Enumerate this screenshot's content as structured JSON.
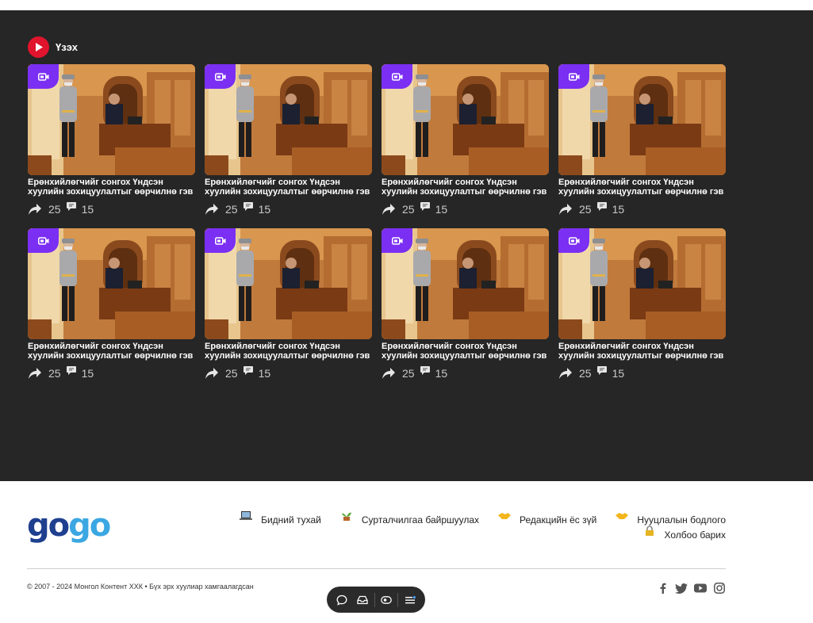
{
  "section": {
    "title": "Үзэх",
    "icon": "play-icon",
    "accent": "#e0142c"
  },
  "cards": [
    {
      "title": "Ерөнхийлөгчийг сонгох Үндсэн хуулийн зохицуулалтыг өөрчилнө гэв үү?",
      "shares": "25",
      "comments": "15"
    },
    {
      "title": "Ерөнхийлөгчийг сонгох Үндсэн хуулийн зохицуулалтыг өөрчилнө гэв үү?",
      "shares": "25",
      "comments": "15"
    },
    {
      "title": "Ерөнхийлөгчийг сонгох Үндсэн хуулийн зохицуулалтыг өөрчилнө гэв үү?",
      "shares": "25",
      "comments": "15"
    },
    {
      "title": "Ерөнхийлөгчийг сонгох Үндсэн хуулийн зохицуулалтыг өөрчилнө гэв үү?",
      "shares": "25",
      "comments": "15"
    },
    {
      "title": "Ерөнхийлөгчийг сонгох Үндсэн хуулийн зохицуулалтыг өөрчилнө гэв үү?",
      "shares": "25",
      "comments": "15"
    },
    {
      "title": "Ерөнхийлөгчийг сонгох Үндсэн хуулийн зохицуулалтыг өөрчилнө гэв үү?",
      "shares": "25",
      "comments": "15"
    },
    {
      "title": "Ерөнхийлөгчийг сонгох Үндсэн хуулийн зохицуулалтыг өөрчилнө гэв үү?",
      "shares": "25",
      "comments": "15"
    },
    {
      "title": "Ерөнхийлөгчийг сонгох Үндсэн хуулийн зохицуулалтыг өөрчилнө гэв үү?",
      "shares": "25",
      "comments": "15"
    }
  ],
  "badge_color": "#7b2ff2",
  "footer": {
    "logo": {
      "part1": "go",
      "part2": "go",
      "color1": "#1f3f8f",
      "color2": "#3ba7e2"
    },
    "links": [
      {
        "label": "Бидний тухай",
        "icon": "laptop-icon"
      },
      {
        "label": "Сурталчилгаа байршуулах",
        "icon": "plant-icon"
      },
      {
        "label": "Редакцийн ёс зүй",
        "icon": "handshake-icon"
      },
      {
        "label": "Нууцлалын бодлого",
        "icon": "handshake-icon"
      },
      {
        "label": "Холбоо барих",
        "icon": "lock-icon"
      }
    ],
    "copyright": "© 2007 - 2024 Монгол Контент ХХК • Бүх эрх хуулиар хамгаалагдсан",
    "socials": [
      "facebook-icon",
      "twitter-icon",
      "youtube-icon",
      "instagram-icon"
    ]
  },
  "toolbar": {
    "items": [
      "chat-icon",
      "inbox-icon",
      "eye-icon",
      "menu-icon"
    ]
  }
}
